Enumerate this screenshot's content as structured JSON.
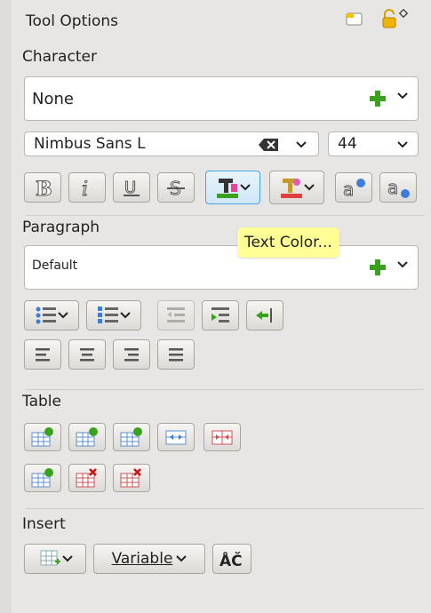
{
  "panel": {
    "title": "Tool Options"
  },
  "character": {
    "heading": "Character",
    "style_value": "None",
    "font_value": "Nimbus Sans L",
    "size_value": "44"
  },
  "paragraph": {
    "heading": "Paragraph",
    "style_value": "Default",
    "tooltip": "Text Color..."
  },
  "table": {
    "heading": "Table"
  },
  "insert": {
    "heading": "Insert",
    "variable_label": "Variable"
  },
  "colors": {
    "accent_plus": "#3aa11f",
    "tooltip_bg": "#ffff96",
    "active_border": "#4aa3df"
  }
}
